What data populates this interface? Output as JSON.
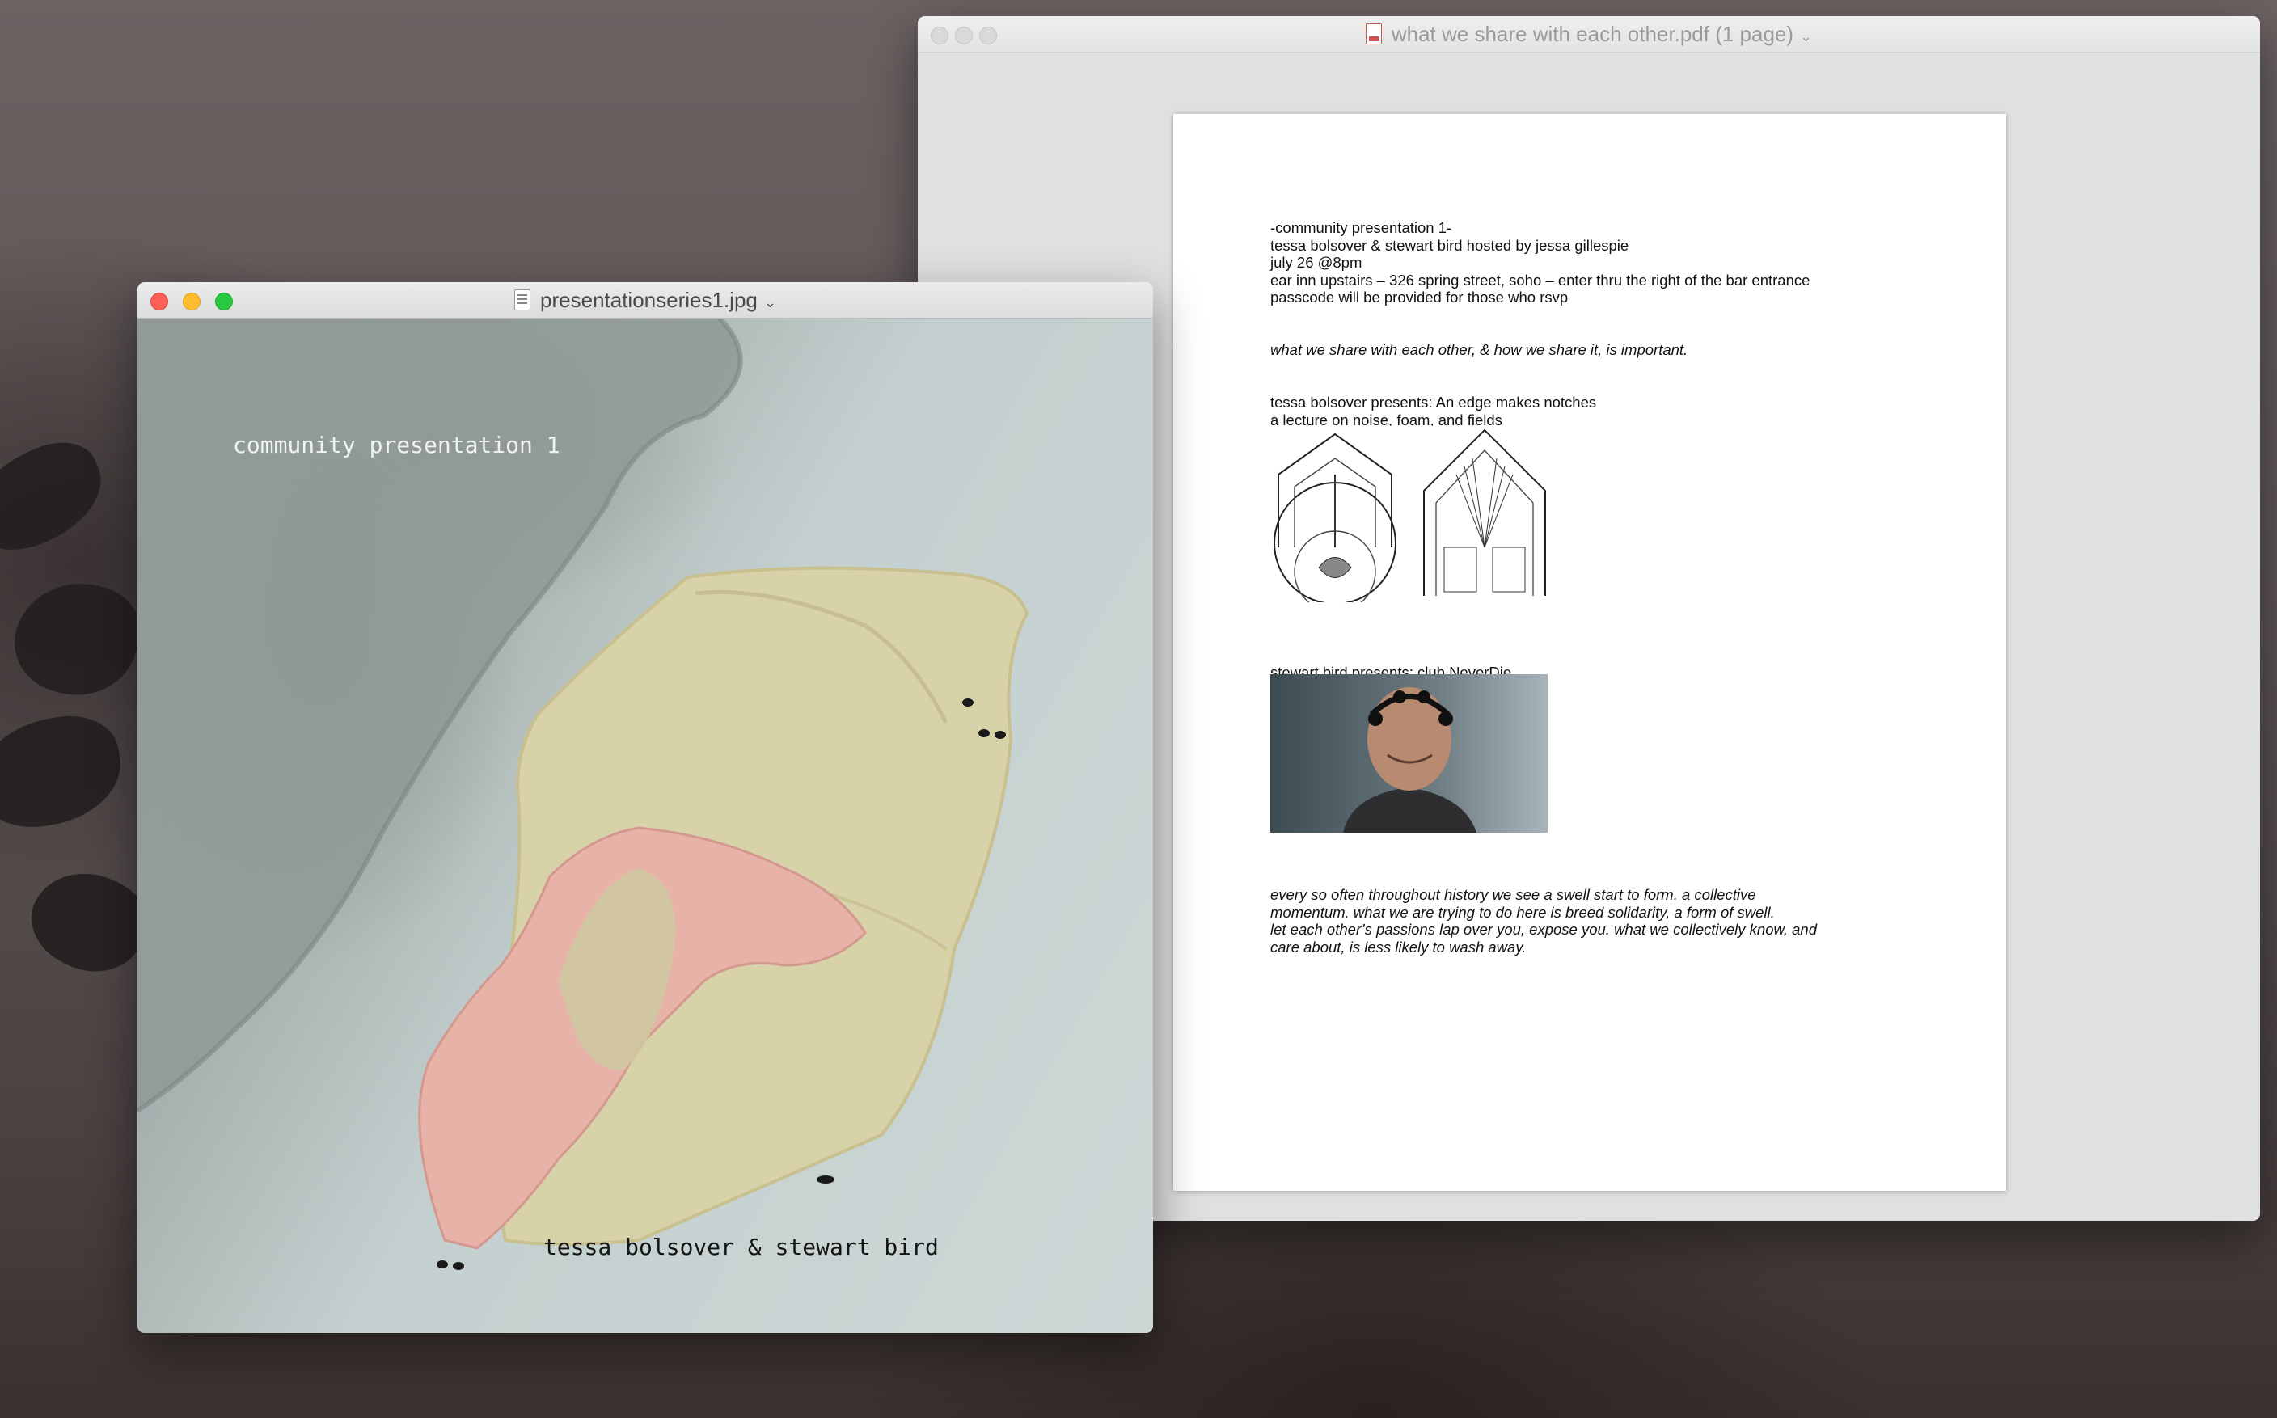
{
  "pdf_window": {
    "title": "what we share with each other.pdf (1 page)",
    "page": {
      "event_lines": [
        "-community presentation 1-",
        "tessa bolsover & stewart bird hosted by jessa gillespie",
        "july 26 @8pm",
        "ear inn upstairs – 326 spring street, soho – enter thru the right of the bar entrance",
        "passcode will be provided for those who rsvp"
      ],
      "tagline": "what we share with each other, & how we share it, is important.",
      "talk1_lines": [
        "tessa bolsover presents: An edge makes notches",
        "a lecture on noise, foam, and fields"
      ],
      "talk2_line": "stewart bird presents: club NeverDie",
      "closing_lines": [
        "every so often throughout history we see a swell start to form. a collective",
        "momentum. what we are trying to do here is breed solidarity, a form of swell.",
        "let each other’s passions lap over you, expose you. what we collectively know, and",
        "care about, is less likely to wash away."
      ]
    }
  },
  "image_window": {
    "title": "presentationseries1.jpg",
    "caption_top": "community presentation 1",
    "caption_bottom": "tessa bolsover & stewart bird"
  },
  "icons": {
    "pdf_title_icon": "pdf-document-icon",
    "image_title_icon": "image-document-icon",
    "title_menu": "chevron-down-icon"
  }
}
